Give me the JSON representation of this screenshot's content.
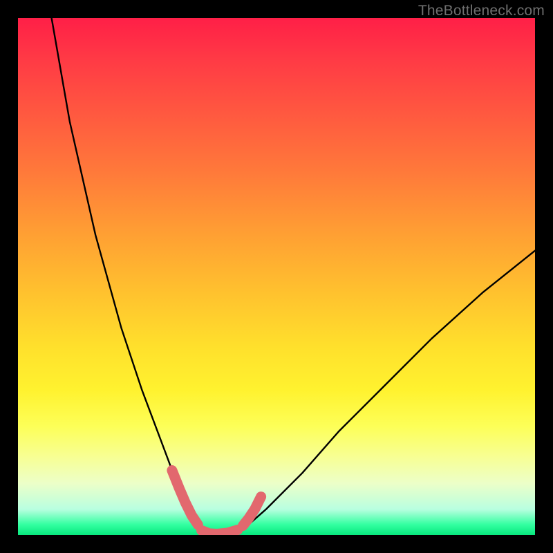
{
  "watermark": {
    "text": "TheBottleneck.com"
  },
  "colors": {
    "background": "#000000",
    "curve": "#000000",
    "highlight": "#e2686e"
  },
  "chart_data": {
    "type": "line",
    "title": "",
    "xlabel": "",
    "ylabel": "",
    "xlim": [
      0,
      100
    ],
    "ylim": [
      0,
      100
    ],
    "grid": false,
    "note": "Synthetic bottleneck curve with unlabeled axes; values are positions read off the graphic (x left→right, y bottom→top).",
    "series": [
      {
        "name": "bottleneck-curve",
        "x": [
          6.5,
          10,
          15,
          20,
          24,
          27,
          30,
          32,
          34,
          36,
          38,
          40,
          44,
          48,
          55,
          62,
          70,
          80,
          90,
          100
        ],
        "y": [
          100,
          80,
          58,
          40,
          28,
          20,
          12,
          6.5,
          3,
          1,
          0,
          0,
          1.5,
          5,
          12,
          20,
          28,
          38,
          47,
          55
        ]
      }
    ],
    "highlight_region": {
      "approx_x_range": [
        30,
        46
      ],
      "description": "Thick salmon overlay marking near-zero (optimal) bottleneck zone",
      "segments": [
        {
          "x": [
            29.8,
            31.2,
            32.4,
            33.6,
            34.8
          ],
          "y": [
            12.5,
            9.0,
            6.2,
            3.8,
            2.0
          ]
        },
        {
          "x": [
            35.5,
            37.0,
            38.5,
            40.5,
            42.5
          ],
          "y": [
            0.9,
            0.3,
            0.2,
            0.4,
            1.0
          ]
        },
        {
          "x": [
            43.5,
            44.6,
            45.8,
            47.0
          ],
          "y": [
            1.8,
            3.2,
            5.0,
            7.4
          ]
        }
      ]
    }
  }
}
